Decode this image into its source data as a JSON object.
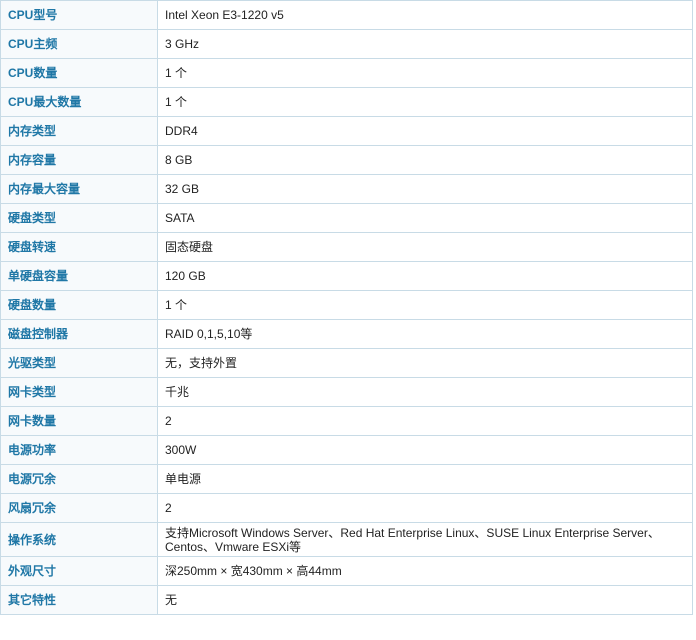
{
  "specs": [
    {
      "label": "CPU型号",
      "value": "Intel Xeon E3-1220 v5"
    },
    {
      "label": "CPU主频",
      "value": "3 GHz"
    },
    {
      "label": "CPU数量",
      "value": "1 个"
    },
    {
      "label": "CPU最大数量",
      "value": "1 个"
    },
    {
      "label": "内存类型",
      "value": "DDR4"
    },
    {
      "label": "内存容量",
      "value": "8 GB"
    },
    {
      "label": "内存最大容量",
      "value": "32 GB"
    },
    {
      "label": "硬盘类型",
      "value": "SATA"
    },
    {
      "label": "硬盘转速",
      "value": "固态硬盘"
    },
    {
      "label": "单硬盘容量",
      "value": "120 GB"
    },
    {
      "label": "硬盘数量",
      "value": "1 个"
    },
    {
      "label": "磁盘控制器",
      "value": "RAID 0,1,5,10等"
    },
    {
      "label": "光驱类型",
      "value": "无，支持外置"
    },
    {
      "label": "网卡类型",
      "value": "千兆"
    },
    {
      "label": "网卡数量",
      "value": "2"
    },
    {
      "label": "电源功率",
      "value": "300W"
    },
    {
      "label": "电源冗余",
      "value": "单电源"
    },
    {
      "label": "风扇冗余",
      "value": "2"
    },
    {
      "label": "操作系统",
      "value": "支持Microsoft Windows Server、Red Hat Enterprise Linux、SUSE Linux Enterprise Server、Centos、Vmware ESXi等"
    },
    {
      "label": "外观尺寸",
      "value": "深250mm × 宽430mm × 高44mm"
    },
    {
      "label": "其它特性",
      "value": "无"
    }
  ]
}
